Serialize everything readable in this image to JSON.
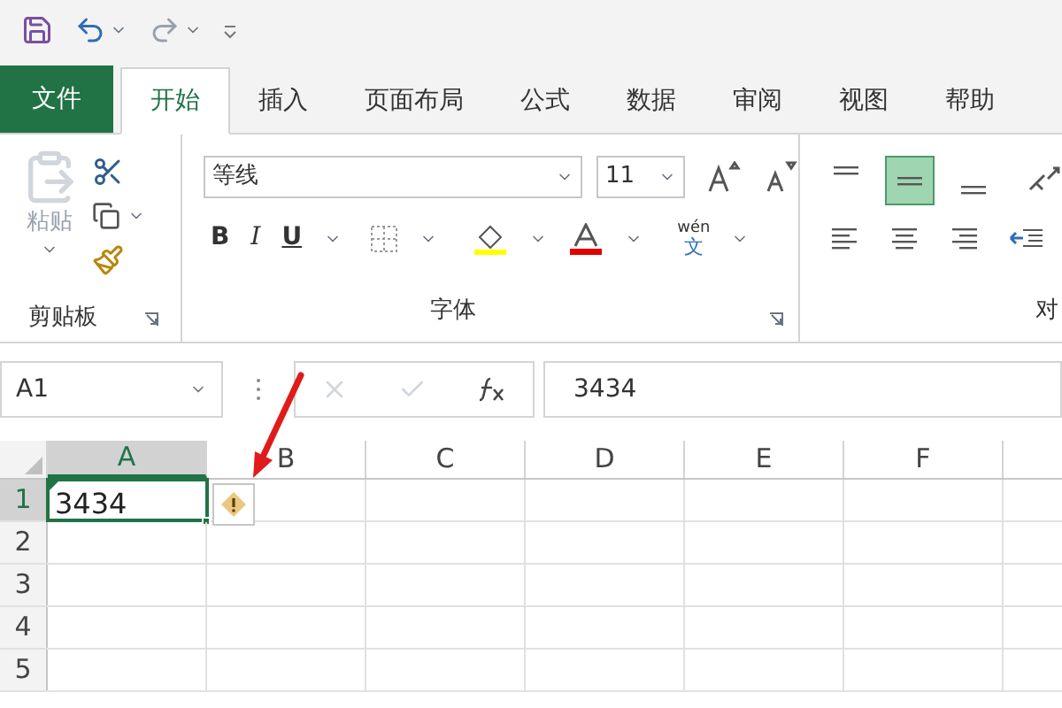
{
  "tabs": [
    {
      "label": "文件",
      "kind": "file",
      "selected": false
    },
    {
      "label": "开始",
      "kind": "tab",
      "selected": true
    },
    {
      "label": "插入",
      "kind": "tab",
      "selected": false
    },
    {
      "label": "页面布局",
      "kind": "tab",
      "selected": false
    },
    {
      "label": "公式",
      "kind": "tab",
      "selected": false
    },
    {
      "label": "数据",
      "kind": "tab",
      "selected": false
    },
    {
      "label": "审阅",
      "kind": "tab",
      "selected": false
    },
    {
      "label": "视图",
      "kind": "tab",
      "selected": false
    },
    {
      "label": "帮助",
      "kind": "tab",
      "selected": false
    }
  ],
  "clipboard": {
    "paste_label": "粘贴",
    "title": "剪贴板"
  },
  "font": {
    "font_name": "等线",
    "font_size": "11",
    "bold": "B",
    "italic": "I",
    "underline": "U",
    "phonetic_top": "wén",
    "phonetic_bottom": "文",
    "title": "字体"
  },
  "alignment": {
    "top_row": [
      {
        "kind": "top",
        "selected": false
      },
      {
        "kind": "middle",
        "selected": true
      },
      {
        "kind": "bottom",
        "selected": false
      }
    ],
    "title": "对"
  },
  "formula_bar": {
    "name_box": "A1",
    "formula": "3434"
  },
  "grid": {
    "columns": [
      {
        "label": "A",
        "selected": true
      },
      {
        "label": "B",
        "selected": false
      },
      {
        "label": "C",
        "selected": false
      },
      {
        "label": "D",
        "selected": false
      },
      {
        "label": "E",
        "selected": false
      },
      {
        "label": "F",
        "selected": false
      }
    ],
    "rows": [
      {
        "label": "1",
        "selected": true,
        "cells": [
          "3434"
        ]
      },
      {
        "label": "2",
        "selected": false,
        "cells": []
      },
      {
        "label": "3",
        "selected": false,
        "cells": []
      },
      {
        "label": "4",
        "selected": false,
        "cells": []
      },
      {
        "label": "5",
        "selected": false,
        "cells": []
      }
    ]
  }
}
